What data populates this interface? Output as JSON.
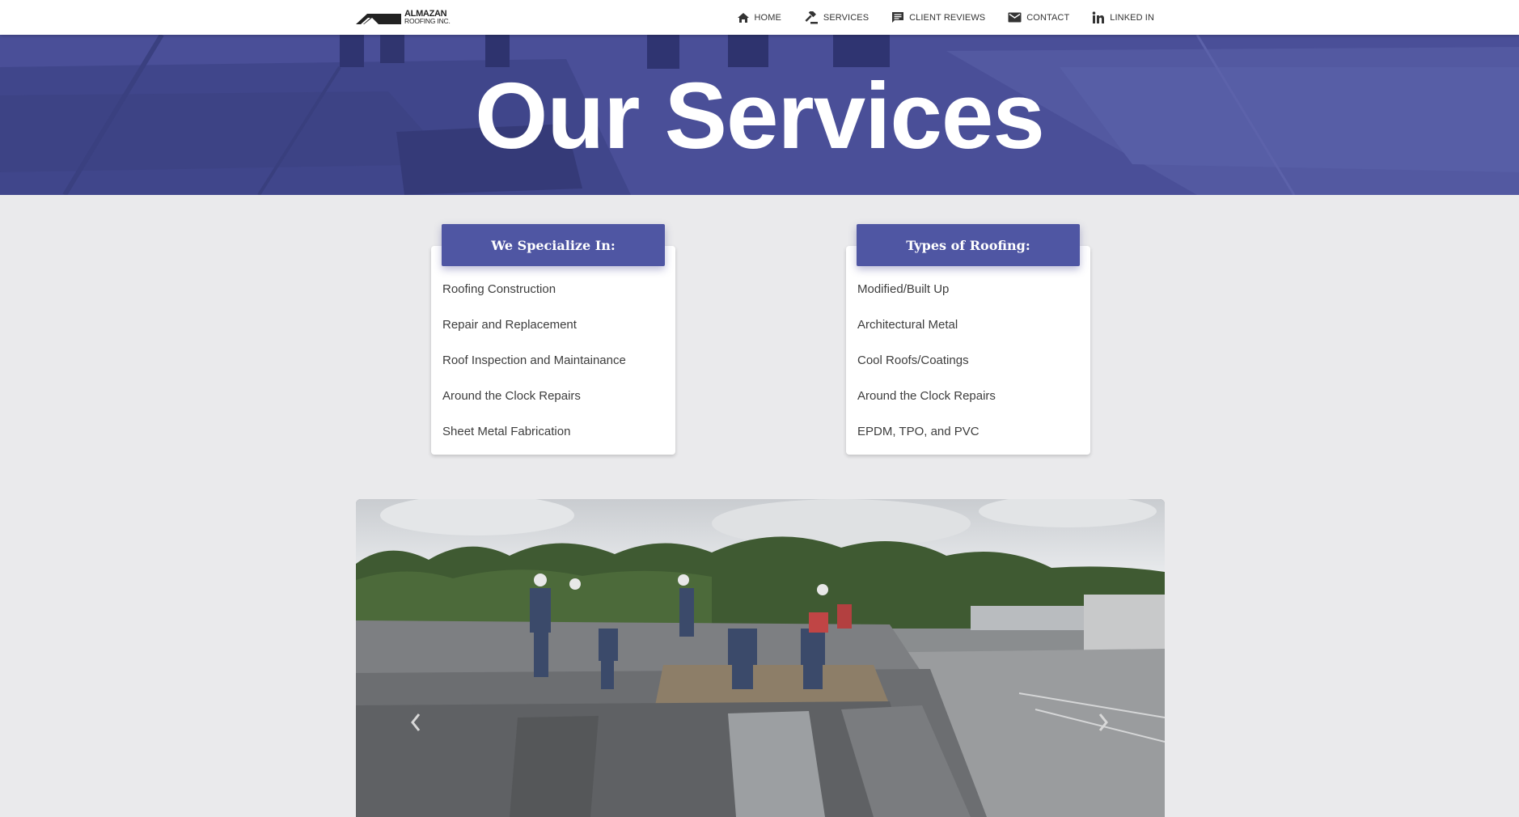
{
  "brand": {
    "name_line1": "ALMAZAN",
    "name_line2": "ROOFING INC."
  },
  "nav": [
    {
      "label": "HOME",
      "icon": "home-icon"
    },
    {
      "label": "SERVICES",
      "icon": "gavel-icon"
    },
    {
      "label": "CLIENT REVIEWS",
      "icon": "comment-icon"
    },
    {
      "label": "CONTACT",
      "icon": "mail-icon"
    },
    {
      "label": "LINKED IN",
      "icon": "linkedin-icon"
    }
  ],
  "hero": {
    "title": "Our Services"
  },
  "specialize": {
    "title": "We Specialize In:",
    "items": [
      "Roofing Construction",
      "Repair and Replacement",
      "Roof Inspection and Maintainance",
      "Around the Clock Repairs",
      "Sheet Metal Fabrication"
    ]
  },
  "roofing_types": {
    "title": "Types of Roofing:",
    "items": [
      "Modified/Built Up",
      "Architectural Metal",
      "Cool Roofs/Coatings",
      "Around the Clock Repairs",
      "EPDM, TPO, and PVC"
    ]
  },
  "carousel": {
    "prev_icon": "chevron-left-icon",
    "next_icon": "chevron-right-icon"
  },
  "colors": {
    "accent": "#4f56a3",
    "hero_tint": "#4a4f98",
    "page_bg": "#eaeaec"
  }
}
